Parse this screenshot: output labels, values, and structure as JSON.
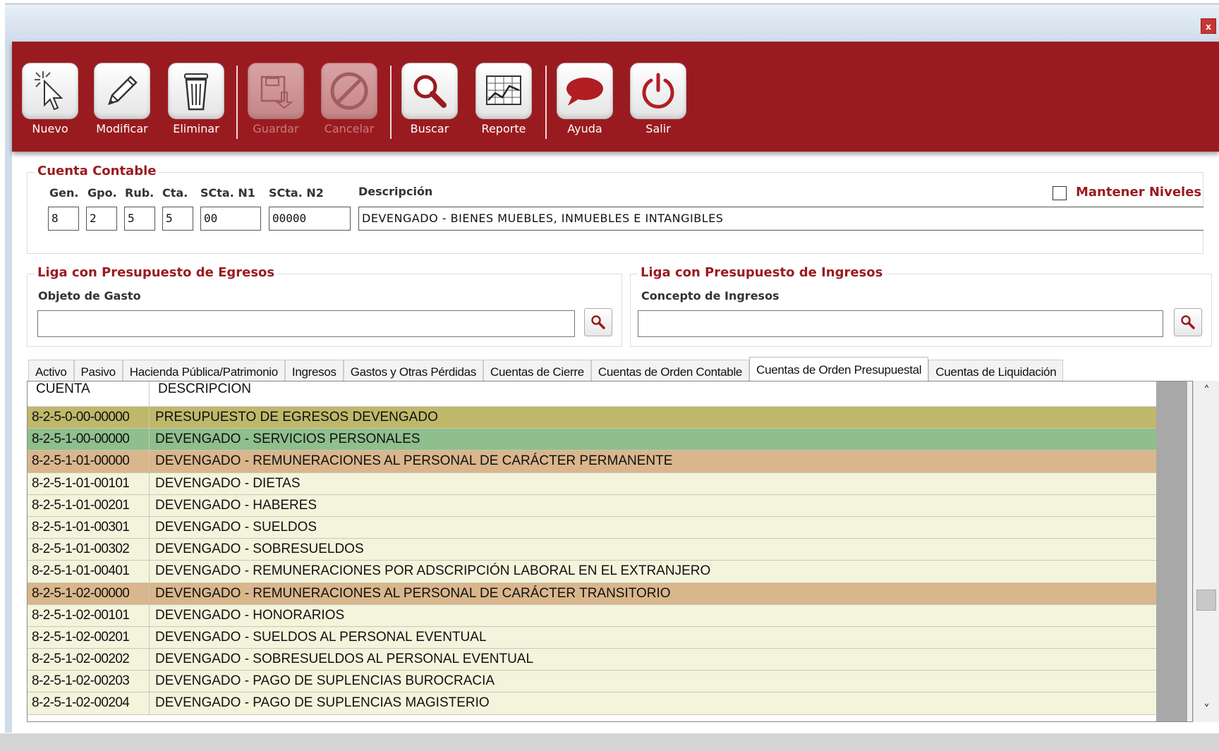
{
  "window": {
    "close": "x"
  },
  "toolbar": {
    "buttons": [
      {
        "label": "Nuevo",
        "enabled": true,
        "icon": "cursor-click-icon"
      },
      {
        "label": "Modificar",
        "enabled": true,
        "icon": "pencil-icon"
      },
      {
        "label": "Eliminar",
        "enabled": true,
        "icon": "trash-icon"
      },
      {
        "label": "Guardar",
        "enabled": false,
        "icon": "save-icon"
      },
      {
        "label": "Cancelar",
        "enabled": false,
        "icon": "cancel-icon"
      },
      {
        "label": "Buscar",
        "enabled": true,
        "icon": "search-icon"
      },
      {
        "label": "Reporte",
        "enabled": true,
        "icon": "chart-icon"
      },
      {
        "label": "Ayuda",
        "enabled": true,
        "icon": "speech-bubble-icon"
      },
      {
        "label": "Salir",
        "enabled": true,
        "icon": "power-icon"
      }
    ],
    "bg_color": "#9a1b1f"
  },
  "cuenta": {
    "title": "Cuenta Contable",
    "labels": {
      "gen": "Gen.",
      "gpo": "Gpo.",
      "rub": "Rub.",
      "cta": "Cta.",
      "scta1": "SCta. N1",
      "scta2": "SCta. N2",
      "desc": "Descripción"
    },
    "values": {
      "gen": "8",
      "gpo": "2",
      "rub": "5",
      "cta": "5",
      "scta1": "00",
      "scta2": "00000",
      "desc": "DEVENGADO - BIENES MUEBLES, INMUEBLES E INTANGIBLES"
    },
    "mantener": "Mantener Niveles",
    "mantener_checked": false
  },
  "egresos": {
    "title": "Liga con Presupuesto  de Egresos",
    "label": "Objeto de Gasto",
    "value": ""
  },
  "ingresos": {
    "title": "Liga con Presupuesto  de Ingresos",
    "label": "Concepto de Ingresos",
    "value": ""
  },
  "tabs": [
    {
      "label": "Activo",
      "active": false
    },
    {
      "label": "Pasivo",
      "active": false
    },
    {
      "label": "Hacienda Pública/Patrimonio",
      "active": false
    },
    {
      "label": "Ingresos",
      "active": false
    },
    {
      "label": "Gastos y Otras Pérdidas",
      "active": false
    },
    {
      "label": "Cuentas de Cierre",
      "active": false
    },
    {
      "label": "Cuentas de Orden Contable",
      "active": false
    },
    {
      "label": "Cuentas de Orden Presupuestal",
      "active": true
    },
    {
      "label": "Cuentas de Liquidación",
      "active": false
    }
  ],
  "grid": {
    "headers": {
      "cuenta": "CUENTA",
      "descripcion": "DESCRIPCION"
    },
    "row_colors": {
      "level1": "#bfb86a",
      "level2": "#8fbf8c",
      "level3": "#d9b68c",
      "leaf": "#f4f4dc"
    },
    "rows": [
      {
        "cuenta": "8-2-5-0-00-00000",
        "descripcion": "PRESUPUESTO DE EGRESOS DEVENGADO",
        "level": "level1"
      },
      {
        "cuenta": "8-2-5-1-00-00000",
        "descripcion": "DEVENGADO - SERVICIOS PERSONALES",
        "level": "level2"
      },
      {
        "cuenta": "8-2-5-1-01-00000",
        "descripcion": "DEVENGADO - REMUNERACIONES AL PERSONAL DE CARÁCTER PERMANENTE",
        "level": "level3"
      },
      {
        "cuenta": "8-2-5-1-01-00101",
        "descripcion": "DEVENGADO - DIETAS",
        "level": "leaf"
      },
      {
        "cuenta": "8-2-5-1-01-00201",
        "descripcion": "DEVENGADO - HABERES",
        "level": "leaf"
      },
      {
        "cuenta": "8-2-5-1-01-00301",
        "descripcion": "DEVENGADO - SUELDOS",
        "level": "leaf"
      },
      {
        "cuenta": "8-2-5-1-01-00302",
        "descripcion": "DEVENGADO - SOBRESUELDOS",
        "level": "leaf"
      },
      {
        "cuenta": "8-2-5-1-01-00401",
        "descripcion": "DEVENGADO - REMUNERACIONES POR ADSCRIPCIÓN LABORAL EN EL EXTRANJERO",
        "level": "leaf"
      },
      {
        "cuenta": "8-2-5-1-02-00000",
        "descripcion": "DEVENGADO - REMUNERACIONES AL PERSONAL DE CARÁCTER TRANSITORIO",
        "level": "level3"
      },
      {
        "cuenta": "8-2-5-1-02-00101",
        "descripcion": "DEVENGADO - HONORARIOS",
        "level": "leaf"
      },
      {
        "cuenta": "8-2-5-1-02-00201",
        "descripcion": "DEVENGADO - SUELDOS AL PERSONAL EVENTUAL",
        "level": "leaf"
      },
      {
        "cuenta": "8-2-5-1-02-00202",
        "descripcion": "DEVENGADO - SOBRESUELDOS AL PERSONAL EVENTUAL",
        "level": "leaf"
      },
      {
        "cuenta": "8-2-5-1-02-00203",
        "descripcion": "DEVENGADO - PAGO DE SUPLENCIAS BUROCRACIA",
        "level": "leaf"
      },
      {
        "cuenta": "8-2-5-1-02-00204",
        "descripcion": "DEVENGADO - PAGO DE SUPLENCIAS MAGISTERIO",
        "level": "leaf"
      }
    ]
  },
  "scrollbar": {
    "up": "˄",
    "down": "˅"
  }
}
